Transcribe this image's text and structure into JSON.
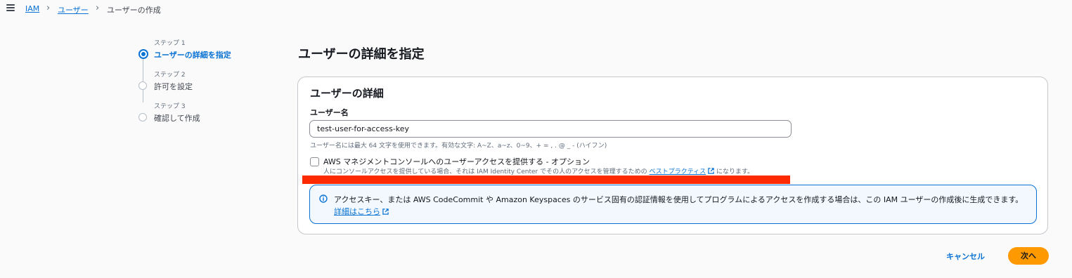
{
  "breadcrumb": {
    "items": [
      "IAM",
      "ユーザー"
    ],
    "current": "ユーザーの作成"
  },
  "steps": [
    {
      "label": "ステップ 1",
      "title": "ユーザーの詳細を指定",
      "active": true
    },
    {
      "label": "ステップ 2",
      "title": "許可を設定",
      "active": false
    },
    {
      "label": "ステップ 3",
      "title": "確認して作成",
      "active": false
    }
  ],
  "page": {
    "title": "ユーザーの詳細を指定"
  },
  "panel": {
    "title": "ユーザーの詳細",
    "username_label": "ユーザー名",
    "username_value": "test-user-for-access-key",
    "constraint": "ユーザー名には最大 64 文字を使用できます。有効な文字: A~Z、a~z、0~9、+ = , . @ _ - (ハイフン)",
    "console_access": {
      "checked": false,
      "label": "AWS マネジメントコンソールへのユーザーアクセスを提供する - オプション",
      "desc_prefix": "人にコンソールアクセスを提供している場合、それは IAM Identity Center でその人のアクセスを管理するための",
      "desc_link": "ベストプラクティス",
      "desc_suffix": "になります。"
    },
    "info": {
      "text": "アクセスキー、または AWS CodeCommit や Amazon Keyspaces のサービス固有の認証情報を使用してプログラムによるアクセスを作成する場合は、この IAM ユーザーの作成後に生成できます。",
      "link": "詳細はこちら"
    }
  },
  "actions": {
    "cancel": "キャンセル",
    "next": "次へ"
  },
  "colors": {
    "accent": "#0972d3",
    "primary_button": "#ff9900",
    "redaction": "#ff2a00"
  }
}
